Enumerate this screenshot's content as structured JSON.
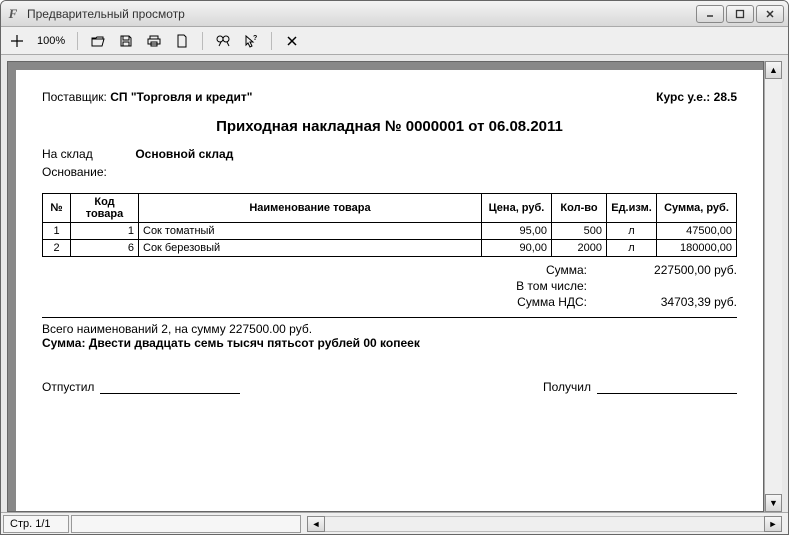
{
  "window": {
    "title": "Предварительный просмотр"
  },
  "toolbar": {
    "zoom": "100%"
  },
  "status": {
    "page": "Стр. 1/1"
  },
  "doc": {
    "supplier_label": "Поставщик:",
    "supplier": "СП \"Торговля и кредит\"",
    "rate_label": "Курс у.е.:",
    "rate": "28.5",
    "title": "Приходная накладная № 0000001 от 06.08.2011",
    "to_warehouse_label": "На склад",
    "to_warehouse": "Основной склад",
    "basis_label": "Основание:",
    "basis": "",
    "columns": {
      "n": "№",
      "code": "Код товара",
      "name": "Наименование товара",
      "price": "Цена, руб.",
      "qty": "Кол-во",
      "unit": "Ед.изм.",
      "sum": "Сумма, руб."
    },
    "rows": [
      {
        "n": "1",
        "code": "1",
        "name": "Сок томатный",
        "price": "95,00",
        "qty": "500",
        "unit": "л",
        "sum": "47500,00"
      },
      {
        "n": "2",
        "code": "6",
        "name": "Сок березовый",
        "price": "90,00",
        "qty": "2000",
        "unit": "л",
        "sum": "180000,00"
      }
    ],
    "totals": {
      "sum_label": "Сумма:",
      "sum": "227500,00 руб.",
      "incl_label": "В том числе:",
      "vat_label": "Сумма НДС:",
      "vat": "34703,39 руб."
    },
    "summary_line": "Всего наименований 2, на сумму 227500.00 руб.",
    "amount_words_label": "Сумма:",
    "amount_words": "Двести двадцать семь тысяч пятьсот рублей 00 копеек",
    "sig_out": "Отпустил",
    "sig_in": "Получил"
  }
}
